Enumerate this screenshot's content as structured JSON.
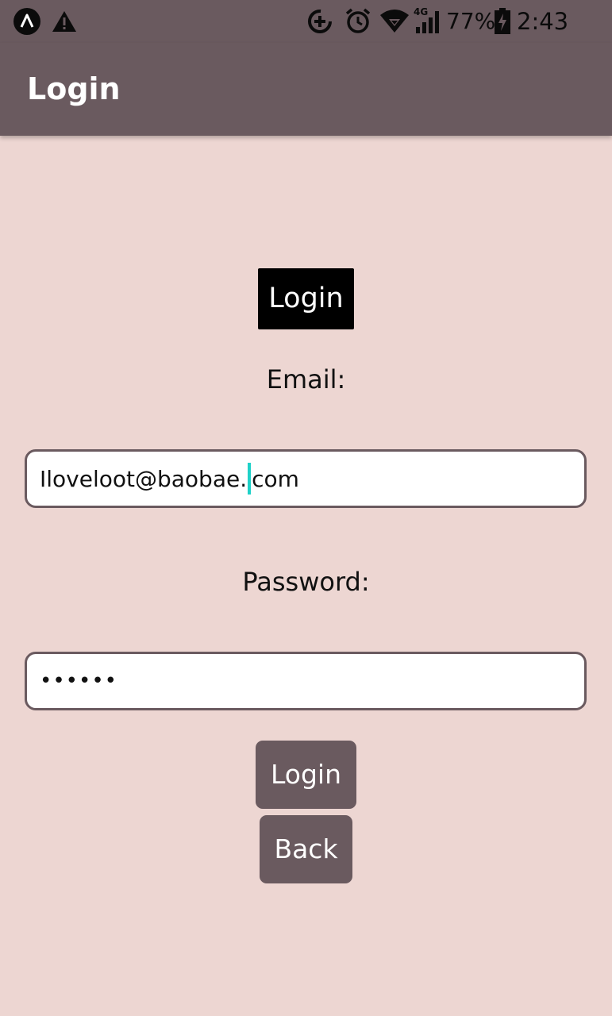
{
  "status_bar": {
    "battery_percent": "77%",
    "time": "2:43 pm",
    "network_type": "4G",
    "icons": [
      "app-logo-icon",
      "warning-icon",
      "data-saver-icon",
      "alarm-icon",
      "wifi-icon",
      "signal-icon",
      "battery-charging-icon"
    ]
  },
  "app_bar": {
    "title": "Login"
  },
  "form": {
    "heading": "Login",
    "email_label": "Email:",
    "email_value_before_caret": "Iloveloot@baobae.",
    "email_value_after_caret": "com",
    "password_label": "Password:",
    "password_value": "••••••",
    "login_button": "Login",
    "back_button": "Back"
  },
  "colors": {
    "app_bar": "#6A5A5F",
    "background": "#EDD6D2",
    "caret": "#1ED1C8",
    "heading_bg": "#000000"
  }
}
